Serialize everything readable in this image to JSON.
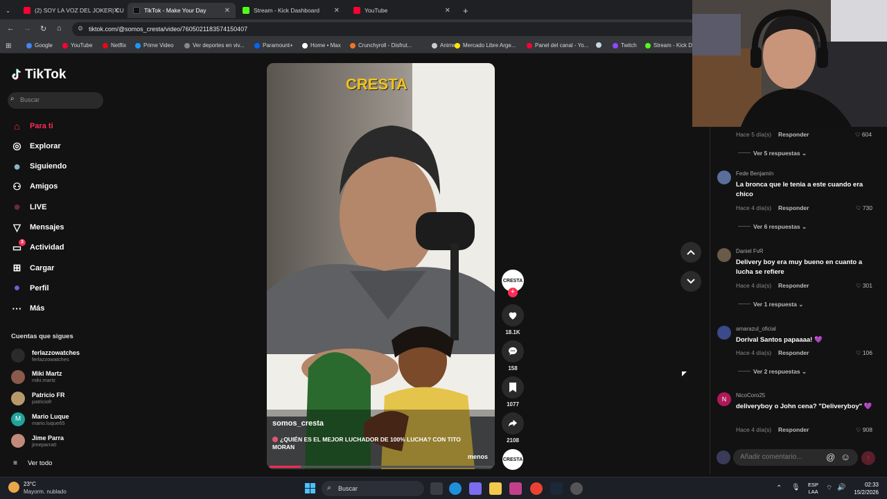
{
  "browser": {
    "tabs": [
      {
        "label": "(2) SOY LA VOZ DEL JOKER| CU",
        "color": "#ff0033"
      },
      {
        "label": "TikTok - Make Your Day",
        "color": "#111111"
      },
      {
        "label": "Stream - Kick Dashboard",
        "color": "#53fc18"
      },
      {
        "label": "YouTube",
        "color": "#ff0033"
      }
    ],
    "url": "tiktok.com/@somos_cresta/video/7605021183574150407",
    "bookmarks": [
      {
        "label": "Google",
        "color": "#4285f4"
      },
      {
        "label": "YouTube",
        "color": "#ff0033"
      },
      {
        "label": "Netflix",
        "color": "#e50914"
      },
      {
        "label": "Prime Video",
        "color": "#1a98ff"
      },
      {
        "label": "Ver deportes en viv...",
        "color": "#888888"
      },
      {
        "label": "Paramount+",
        "color": "#0064ff"
      },
      {
        "label": "Home • Max",
        "color": "#ffffff"
      },
      {
        "label": "Crunchyroll - Disfrut...",
        "color": "#f47521"
      },
      {
        "label": "Anime",
        "color": "#cccccc"
      },
      {
        "label": "Mercado Libre Arge...",
        "color": "#ffe600"
      },
      {
        "label": "Panel del canal - Yo...",
        "color": "#ff0033"
      },
      {
        "label": "",
        "color": "#c7d5e0"
      },
      {
        "label": "Twitch",
        "color": "#9146ff"
      },
      {
        "label": "Stream - Kick D",
        "color": "#53fc18"
      }
    ]
  },
  "sidebar": {
    "logo": "TikTok",
    "search_placeholder": "Buscar",
    "nav": [
      {
        "label": "Para ti",
        "icon": "home-icon"
      },
      {
        "label": "Explorar",
        "icon": "compass-icon"
      },
      {
        "label": "Siguiendo",
        "icon": "following-avatar-icon"
      },
      {
        "label": "Amigos",
        "icon": "friends-icon"
      },
      {
        "label": "LIVE",
        "icon": "live-icon"
      },
      {
        "label": "Mensajes",
        "icon": "messages-icon"
      },
      {
        "label": "Actividad",
        "icon": "activity-icon",
        "badge": "3"
      },
      {
        "label": "Cargar",
        "icon": "upload-icon"
      },
      {
        "label": "Perfil",
        "icon": "profile-icon"
      },
      {
        "label": "Más",
        "icon": "more-icon"
      }
    ],
    "following_title": "Cuentas que sigues",
    "following": [
      {
        "name": "ferlazzowatches",
        "handle": "ferlazzowatches",
        "color": "#2b2b2b"
      },
      {
        "name": "Miki Martz",
        "handle": "miki.martz",
        "color": "#8a5a4a"
      },
      {
        "name": "Patricio FR",
        "handle": "patriciofr",
        "color": "#b89a6a"
      },
      {
        "name": "Mario Luque",
        "handle": "mario.luque65",
        "color": "#20a39a"
      },
      {
        "name": "Jime Parra",
        "handle": "jimeparra0",
        "color": "#c28a7a"
      }
    ],
    "see_all": "Ver todo"
  },
  "video": {
    "brand_overlay": "CRESTA",
    "author": "somos_cresta",
    "caption": "¿QUIÉN ES EL MEJOR LUCHADOR DE 100% LUCHA? CON TITO MORAN",
    "more_label": "menos",
    "progress": 0.14,
    "likes": "18.1K",
    "comments": "158",
    "saves": "1077",
    "shares": "2108"
  },
  "comments": {
    "top_partial": {
      "meta": "Hace 5 día(s)",
      "reply": "Responder",
      "likes": "604",
      "replies": "Ver 5 respuestas"
    },
    "items": [
      {
        "user": "Fede Benjamín",
        "text": "La bronca que le tenia a este cuando era chico",
        "meta": "Hace 4 día(s)",
        "reply": "Responder",
        "likes": "730",
        "replies": "Ver 6 respuestas",
        "color": "#5a6e9a"
      },
      {
        "user": "Daniel FvR",
        "text": "Delivery boy era muy bueno en cuanto a lucha se refiere",
        "meta": "Hace 4 día(s)",
        "reply": "Responder",
        "likes": "301",
        "replies": "Ver 1 respuesta",
        "color": "#6a5a4a"
      },
      {
        "user": "amarazul_oficial",
        "text": "Dorival Santos papaaaa! 💜",
        "meta": "Hace 4 día(s)",
        "reply": "Responder",
        "likes": "106",
        "replies": "Ver 2 respuestas",
        "color": "#3a4a8a"
      },
      {
        "user": "NicoCoro25",
        "text": "deliveryboy o John cena? \"Deliveryboy\" 💜",
        "meta": "Hace 4 día(s)",
        "reply": "Responder",
        "likes": "908",
        "replies": "",
        "color": "#b0185a",
        "initial": "N"
      }
    ],
    "input_placeholder": "Añadir comentario..."
  },
  "taskbar": {
    "weather_temp": "23°C",
    "weather_desc": "Mayorm. nublado",
    "search": "Buscar",
    "lang1": "ESP",
    "lang2": "LAA",
    "time": "02:33",
    "date": "15/2/2026"
  }
}
